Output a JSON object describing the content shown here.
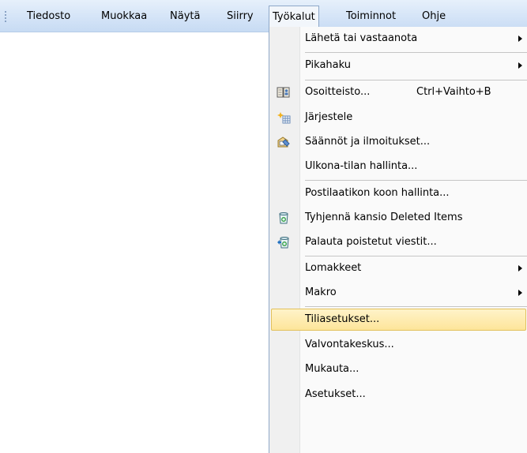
{
  "menubar": {
    "items": [
      {
        "label": "Tiedosto",
        "active": false
      },
      {
        "label": "Muokkaa",
        "active": false
      },
      {
        "label": "Näytä",
        "active": false
      },
      {
        "label": "Siirry",
        "active": false
      },
      {
        "label": "Työkalut",
        "active": true
      },
      {
        "label": "Toiminnot",
        "active": false
      },
      {
        "label": "Ohje",
        "active": false
      }
    ]
  },
  "tools_menu": {
    "items": [
      {
        "label": "Lähetä tai vastaanota",
        "submenu": true
      },
      {
        "label": "Pikahaku",
        "submenu": true
      },
      {
        "label": "Osoitteisto...",
        "shortcut": "Ctrl+Vaihto+B",
        "icon": "address-book-icon"
      },
      {
        "label": "Järjestele",
        "icon": "organize-icon"
      },
      {
        "label": "Säännöt ja ilmoitukset...",
        "icon": "rules-alerts-icon"
      },
      {
        "label": "Ulkona-tilan hallinta..."
      },
      {
        "label": "Postilaatikon koon hallinta..."
      },
      {
        "label": "Tyhjennä kansio Deleted Items",
        "icon": "empty-deleted-items-icon"
      },
      {
        "label": "Palauta poistetut viestit...",
        "icon": "recover-deleted-items-icon"
      },
      {
        "label": "Lomakkeet",
        "submenu": true
      },
      {
        "label": "Makro",
        "submenu": true
      },
      {
        "label": "Tiliasetukset...",
        "highlighted": true
      },
      {
        "label": "Valvontakeskus..."
      },
      {
        "label": "Mukauta..."
      },
      {
        "label": "Asetukset..."
      }
    ]
  },
  "colors": {
    "menubar_bg": "#d3e3f7",
    "highlight_bg": "#fde59a",
    "highlight_border": "#e2c15c"
  }
}
